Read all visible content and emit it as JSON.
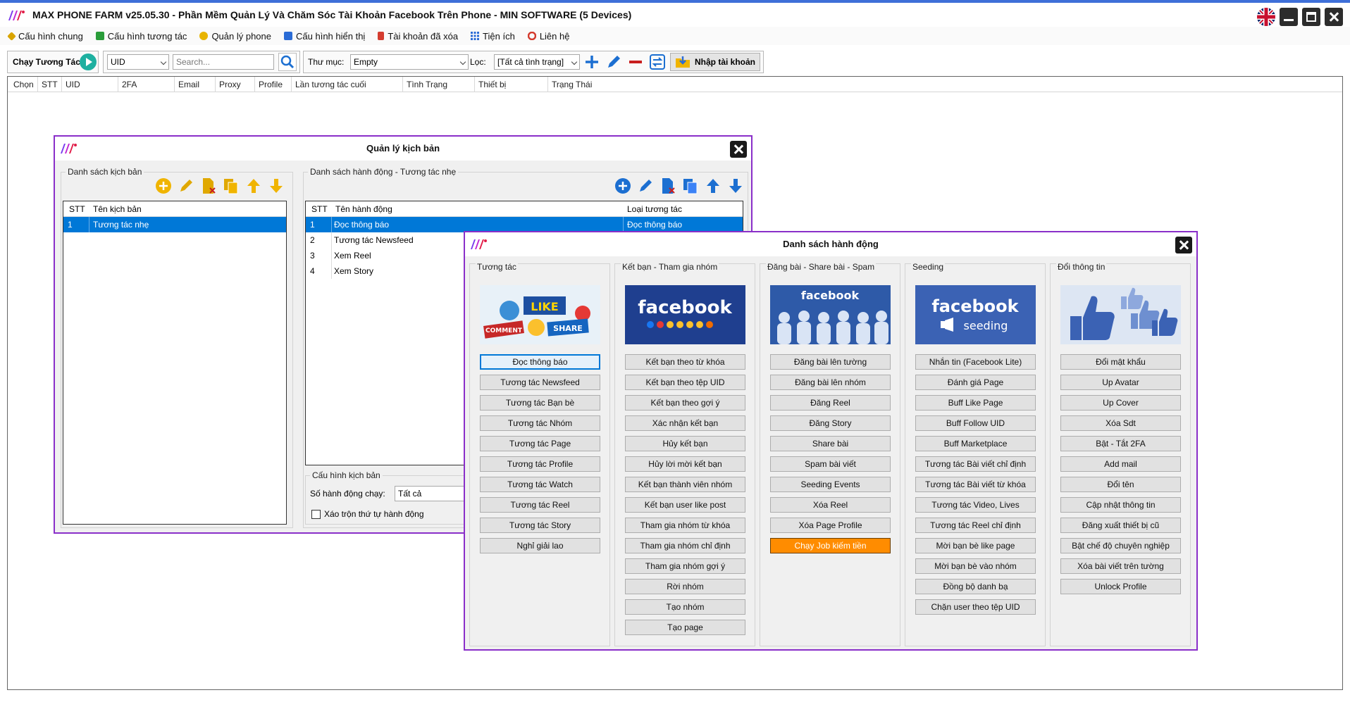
{
  "window": {
    "title": "MAX PHONE FARM v25.05.30 - Phần Mềm Quản Lý Và Chăm Sóc Tài Khoản Facebook Trên Phone - MIN SOFTWARE (5 Devices)"
  },
  "menu": [
    {
      "label": "Cấu hình chung",
      "icon": "wrench-icon",
      "color": "#c98a00"
    },
    {
      "label": "Cấu hình tương tác",
      "icon": "settings-swap-icon",
      "color": "#2a9d3a"
    },
    {
      "label": "Quản lý phone",
      "icon": "phone-icon",
      "color": "#e0a800"
    },
    {
      "label": "Cấu hình hiển thị",
      "icon": "display-icon",
      "color": "#2b6cd6"
    },
    {
      "label": "Tài khoản đã xóa",
      "icon": "trash-icon",
      "color": "#d43c2f"
    },
    {
      "label": "Tiện ích",
      "icon": "grid-icon",
      "color": "#2b6cd6"
    },
    {
      "label": "Liên hệ",
      "icon": "lifebuoy-icon",
      "color": "#d43c2f"
    }
  ],
  "toolbar": {
    "run_label": "Chạy Tương Tác",
    "uid_select": "UID",
    "search_placeholder": "Search...",
    "folder_label": "Thư mục:",
    "folder_value": "Empty",
    "filter_label": "Lọc:",
    "filter_value": "[Tất cả tình trạng]",
    "import_label": "Nhập tài khoản"
  },
  "main_grid": {
    "columns": [
      "Chọn",
      "STT",
      "UID",
      "2FA",
      "Email",
      "Proxy",
      "Profile",
      "Lần tương tác cuối",
      "Tình Trạng",
      "Thiết bị",
      "Trạng Thái"
    ]
  },
  "script_dialog": {
    "title": "Quản lý kịch bản",
    "scripts_legend": "Danh sách kịch bản",
    "scripts_columns": [
      "STT",
      "Tên kịch bản"
    ],
    "scripts": [
      {
        "stt": "1",
        "name": "Tương tác nhẹ"
      }
    ],
    "actions_legend": "Danh sách hành động - Tương tác nhẹ",
    "actions_columns": [
      "STT",
      "Tên hành động",
      "Loại tương tác"
    ],
    "actions": [
      {
        "stt": "1",
        "name": "Đọc thông báo",
        "type": "Đọc thông báo"
      },
      {
        "stt": "2",
        "name": "Tương tác Newsfeed",
        "type": ""
      },
      {
        "stt": "3",
        "name": "Xem Reel",
        "type": ""
      },
      {
        "stt": "4",
        "name": "Xem Story",
        "type": ""
      }
    ],
    "config_legend": "Cấu hình kịch bản",
    "run_count_label": "Số hành động chạy:",
    "run_count_value": "Tất cả",
    "shuffle_label": "Xáo trộn thứ tự hành động"
  },
  "action_dialog": {
    "title": "Danh sách hành động",
    "columns": [
      {
        "title": "Tương tác",
        "image": "like-share-comment-art",
        "buttons": [
          "Đọc thông báo",
          "Tương tác Newsfeed",
          "Tương tác Bạn bè",
          "Tương tác Nhóm",
          "Tương tác Page",
          "Tương tác Profile",
          "Tương tác Watch",
          "Tương tác Reel",
          "Tương tác Story",
          "Nghỉ giải lao"
        ]
      },
      {
        "title": "Kết bạn - Tham gia nhóm",
        "image": "facebook-reactions-art",
        "image_text": "facebook",
        "buttons": [
          "Kết bạn theo từ khóa",
          "Kết bạn theo tệp UID",
          "Kết bạn theo gợi ý",
          "Xác nhận kết bạn",
          "Hủy kết bạn",
          "Hủy lời mời kết bạn",
          "Kết bạn thành viên nhóm",
          "Kết bạn user like post",
          "Tham gia nhóm từ khóa",
          "Tham gia nhóm chỉ định",
          "Tham gia nhóm gợi ý",
          "Rời nhóm",
          "Tạo nhóm",
          "Tạo page"
        ]
      },
      {
        "title": "Đăng bài - Share bài - Spam",
        "image": "facebook-crowd-art",
        "image_text": "facebook",
        "buttons": [
          "Đăng bài lên tường",
          "Đăng bài lên nhóm",
          "Đăng Reel",
          "Đăng Story",
          "Share bài",
          "Spam bài viết",
          "Seeding Events",
          "Xóa Reel",
          "Xóa Page Profile",
          "Chạy Job kiếm tiền"
        ]
      },
      {
        "title": "Seeding",
        "image": "facebook-seeding-art",
        "image_text": "facebook",
        "image_subtext": "seeding",
        "buttons": [
          "Nhắn tin (Facebook Lite)",
          "Đánh giá Page",
          "Buff Like Page",
          "Buff Follow UID",
          "Buff Marketplace",
          "Tương tác Bài viết chỉ định",
          "Tương tác Bài viết từ khóa",
          "Tương tác Video, Lives",
          "Tương tác Reel chỉ định",
          "Mời bạn bè like page",
          "Mời bạn bè vào nhóm",
          "Đồng bộ danh bạ",
          "Chặn user theo tệp UID"
        ]
      },
      {
        "title": "Đổi thông tin",
        "image": "thumbs-up-art",
        "buttons": [
          "Đổi mật khẩu",
          "Up Avatar",
          "Up Cover",
          "Xóa Sdt",
          "Bật - Tắt 2FA",
          "Add mail",
          "Đổi tên",
          "Cập nhật thông tin",
          "Đăng xuất thiết bị cũ",
          "Bật chế độ chuyên nghiệp",
          "Xóa bài viết trên tường",
          "Unlock Profile"
        ]
      }
    ]
  },
  "colors": {
    "accent_purple": "#8a2fc9",
    "selection_blue": "#0078d7",
    "highlight_orange": "#ff8c00",
    "facebook_blue": "#3b5998"
  }
}
